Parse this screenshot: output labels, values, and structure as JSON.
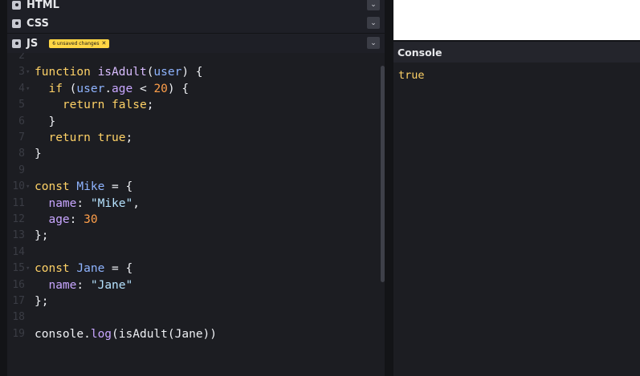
{
  "panels": {
    "html_label": "HTML",
    "css_label": "CSS",
    "js_label": "JS",
    "js_badge": "6 unsaved changes",
    "badge_close": "✕",
    "chevron": "⌄"
  },
  "editor": {
    "lines": [
      {
        "n": "2",
        "fold": false,
        "tokens": []
      },
      {
        "n": "3",
        "fold": true,
        "tokens": [
          {
            "t": "function ",
            "c": "kw"
          },
          {
            "t": "isAdult",
            "c": "fn"
          },
          {
            "t": "(",
            "c": ""
          },
          {
            "t": "user",
            "c": "param"
          },
          {
            "t": ") {",
            "c": ""
          }
        ]
      },
      {
        "n": "4",
        "fold": true,
        "tokens": [
          {
            "t": "  if ",
            "c": "kw"
          },
          {
            "t": "(",
            "c": ""
          },
          {
            "t": "user",
            "c": "param"
          },
          {
            "t": ".",
            "c": ""
          },
          {
            "t": "age",
            "c": "prop"
          },
          {
            "t": " < ",
            "c": ""
          },
          {
            "t": "20",
            "c": "num"
          },
          {
            "t": ") {",
            "c": ""
          }
        ]
      },
      {
        "n": "5",
        "fold": false,
        "tokens": [
          {
            "t": "    return ",
            "c": "kw"
          },
          {
            "t": "false",
            "c": "kw"
          },
          {
            "t": ";",
            "c": ""
          }
        ]
      },
      {
        "n": "6",
        "fold": false,
        "tokens": [
          {
            "t": "  }",
            "c": ""
          }
        ]
      },
      {
        "n": "7",
        "fold": false,
        "tokens": [
          {
            "t": "  return ",
            "c": "kw"
          },
          {
            "t": "true",
            "c": "kw"
          },
          {
            "t": ";",
            "c": ""
          }
        ]
      },
      {
        "n": "8",
        "fold": false,
        "tokens": [
          {
            "t": "}",
            "c": ""
          }
        ]
      },
      {
        "n": "9",
        "fold": false,
        "tokens": []
      },
      {
        "n": "10",
        "fold": true,
        "tokens": [
          {
            "t": "const ",
            "c": "kw"
          },
          {
            "t": "Mike",
            "c": "param"
          },
          {
            "t": " = {",
            "c": ""
          }
        ]
      },
      {
        "n": "11",
        "fold": false,
        "tokens": [
          {
            "t": "  name",
            "c": "prop"
          },
          {
            "t": ": ",
            "c": ""
          },
          {
            "t": "\"Mike\"",
            "c": "str"
          },
          {
            "t": ",",
            "c": ""
          }
        ]
      },
      {
        "n": "12",
        "fold": false,
        "tokens": [
          {
            "t": "  age",
            "c": "prop"
          },
          {
            "t": ": ",
            "c": ""
          },
          {
            "t": "30",
            "c": "num"
          }
        ]
      },
      {
        "n": "13",
        "fold": false,
        "tokens": [
          {
            "t": "};",
            "c": ""
          }
        ]
      },
      {
        "n": "14",
        "fold": false,
        "tokens": []
      },
      {
        "n": "15",
        "fold": true,
        "tokens": [
          {
            "t": "const ",
            "c": "kw"
          },
          {
            "t": "Jane",
            "c": "param"
          },
          {
            "t": " = {",
            "c": ""
          }
        ]
      },
      {
        "n": "16",
        "fold": false,
        "tokens": [
          {
            "t": "  name",
            "c": "prop"
          },
          {
            "t": ": ",
            "c": ""
          },
          {
            "t": "\"Jane\"",
            "c": "str"
          }
        ]
      },
      {
        "n": "17",
        "fold": false,
        "tokens": [
          {
            "t": "};",
            "c": ""
          }
        ]
      },
      {
        "n": "18",
        "fold": false,
        "tokens": []
      },
      {
        "n": "19",
        "fold": false,
        "tokens": [
          {
            "t": "console",
            "c": ""
          },
          {
            "t": ".",
            "c": ""
          },
          {
            "t": "log",
            "c": "prop"
          },
          {
            "t": "(",
            "c": ""
          },
          {
            "t": "isAdult",
            "c": ""
          },
          {
            "t": "(",
            "c": ""
          },
          {
            "t": "Jane",
            "c": ""
          },
          {
            "t": "))",
            "c": ""
          }
        ]
      }
    ]
  },
  "console": {
    "title": "Console",
    "output": "true"
  }
}
